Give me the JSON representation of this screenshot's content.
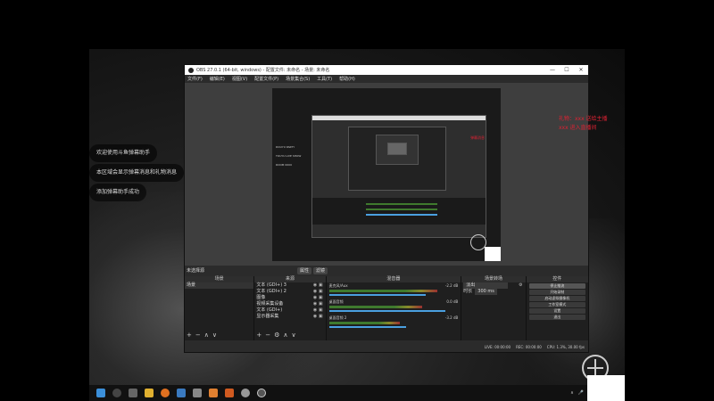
{
  "desktop": {
    "notifications": [
      "欢迎使用斗鱼弹幕助手",
      "本区域会显示弹幕消息和礼物消息",
      "添加弹幕助手成功"
    ],
    "red_overlay": [
      "礼物：xxx 送给主播",
      "xxx 进入直播间"
    ],
    "preview_red": "弹幕消息"
  },
  "obs": {
    "title": "OBS 27.0.1 (64-bit, windows) - 配置文件: 未命名 - 场景: 未命名",
    "window_controls": [
      "—",
      "☐",
      "✕"
    ],
    "menu": [
      "文件(F)",
      "编辑(E)",
      "视图(V)",
      "配置文件(P)",
      "场景集合(S)",
      "工具(T)",
      "帮助(H)"
    ],
    "preview_texts": [
      "DOUYU PARTY",
      "TOUYU LIVE SHOW",
      "ROOM 0000"
    ],
    "source_bar": {
      "label": "未选择源",
      "properties": "属性",
      "filters": "滤镜"
    },
    "docks": {
      "scenes": {
        "header": "场景",
        "items": [
          "场景"
        ]
      },
      "sources": {
        "header": "来源",
        "items": [
          "文本 (GDI+) 3",
          "文本 (GDI+) 2",
          "图像",
          "视频采集设备",
          "文本 (GDI+)",
          "显示器采集"
        ]
      },
      "mixer": {
        "header": "混音器",
        "channels": [
          {
            "name": "麦克风/Aux",
            "db": "-2.2 dB",
            "level": 0.84,
            "volume": 0.75
          },
          {
            "name": "桌面音频",
            "db": "0.0 dB",
            "level": 0.72,
            "volume": 0.9
          },
          {
            "name": "桌面音频 2",
            "db": "-3.2 dB",
            "level": 0.55,
            "volume": 0.6
          }
        ]
      },
      "transitions": {
        "header": "场景转场",
        "type": "淡出",
        "duration_label": "时长",
        "duration": "300 ms"
      },
      "controls": {
        "header": "控件",
        "buttons": [
          "停止推流",
          "开始录制",
          "启动虚拟摄像机",
          "工作室模式",
          "设置",
          "退出"
        ]
      }
    },
    "status": {
      "live": "LIVE: 00:00:00",
      "rec": "REC: 00:00:00",
      "cpu": "CPU: 1.3%, 30.00 fps"
    }
  },
  "taskbar": {
    "time": "20",
    "lang": "中"
  }
}
